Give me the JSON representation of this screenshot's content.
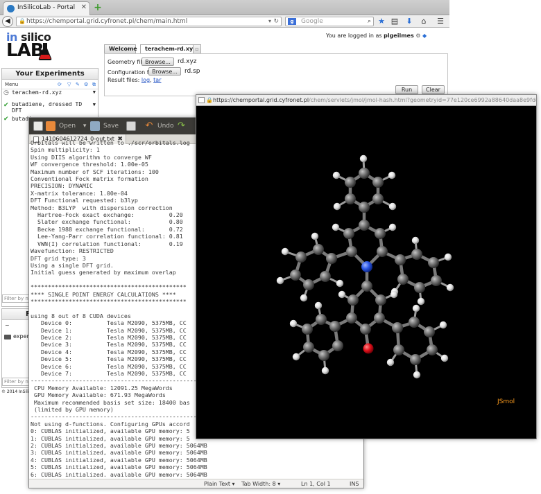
{
  "browser": {
    "tab_title": "InSilicoLab - Portal",
    "url": "https://chemportal.grid.cyfronet.pl/chem/main.html",
    "search_placeholder": "Google",
    "search_engine_icon": "google-g-icon"
  },
  "portal": {
    "logo_line1_a": "in",
    "logo_line1_b": " silico",
    "logo_line2": "LAB",
    "logged_in_prefix": "You are logged in as",
    "username": "plgeilmes",
    "experiments_panel": {
      "title": "Your Experiments",
      "menu_label": "Menu",
      "items": [
        {
          "label": "terachem-rd.xyz",
          "status": "running"
        },
        {
          "label": "butadiene, dressed TD DFT",
          "status": "done"
        },
        {
          "label": "butadi",
          "status": "done"
        }
      ],
      "filter_placeholder": "Filter by na"
    },
    "files_panel": {
      "title_initial": "F",
      "items": [
        {
          "label": "~"
        },
        {
          "label": "exper"
        }
      ],
      "filter_placeholder": "Filter by na"
    },
    "copyright": "© 2014 InSilico",
    "tabs": [
      {
        "label": "Welcome"
      },
      {
        "label": "terachem-rd.xyz"
      }
    ],
    "form": {
      "geometry_label": "Geometry file:",
      "geometry_value": "rd.xyz",
      "config_label": "Configuration file:",
      "config_value": "rd.sp",
      "browse_label": "Browse...",
      "result_label": "Result files:",
      "result_log": "log",
      "result_sep": ",",
      "result_tar": "tar",
      "run_label": "Run",
      "clear_label": "Clear"
    }
  },
  "editor": {
    "toolbar": {
      "open_label": "Open",
      "save_label": "Save",
      "undo_label": "Undo"
    },
    "tab_title": "1410604612724_0-out.txt",
    "lines": [
      "Orbitals will be written to ./scr/orbitals.log",
      "Spin multiplicity: 1",
      "Using DIIS algorithm to converge WF",
      "WF convergence threshold: 1.00e-05",
      "Maximum number of SCF iterations: 100",
      "Conventional Fock matrix formation",
      "PRECISION: DYNAMIC",
      "X-matrix tolerance: 1.00e-04",
      "DFT Functional requested: b3lyp",
      "Method: B3LYP  with dispersion correction",
      "  Hartree-Fock exact exchange:          0.20",
      "  Slater exchange functional:           0.80",
      "  Becke 1988 exchange functional:       0.72",
      "  Lee-Yang-Parr correlation functional: 0.81",
      "  VWN(I) correlation functional:        0.19",
      "Wavefunction: RESTRICTED",
      "DFT grid type: 3",
      "Using a single DFT grid.",
      "Initial guess generated by maximum overlap",
      "",
      "*********************************************",
      "**** SINGLE POINT ENERGY CALCULATIONS ****",
      "*********************************************",
      "",
      "using 8 out of 8 CUDA devices",
      "   Device 0:          Tesla M2090, 5375MB, CC",
      "   Device 1:          Tesla M2090, 5375MB, CC",
      "   Device 2:          Tesla M2090, 5375MB, CC",
      "   Device 3:          Tesla M2090, 5375MB, CC",
      "   Device 4:          Tesla M2090, 5375MB, CC",
      "   Device 5:          Tesla M2090, 5375MB, CC",
      "   Device 6:          Tesla M2090, 5375MB, CC",
      "   Device 7:          Tesla M2090, 5375MB, CC",
      "----------------------------------------------------------",
      " CPU Memory Available: 12091.25 MegaWords",
      " GPU Memory Available: 671.93 MegaWords",
      " Maximum recommended basis set size: 18400 bas",
      " (limited by GPU memory)",
      "----------------------------------------------------------",
      "Not using d-functions. Configuring GPUs accord",
      "0: CUBLAS initialized, available GPU memory: 5",
      "1: CUBLAS initialized, available GPU memory: 5",
      "2: CUBLAS initialized, available GPU memory: 5064MB",
      "3: CUBLAS initialized, available GPU memory: 5064MB",
      "4: CUBLAS initialized, available GPU memory: 5064MB",
      "5: CUBLAS initialized, available GPU memory: 5064MB",
      "6: CUBLAS initialized, available GPU memory: 5064MB"
    ],
    "status": {
      "syntax": "Plain Text",
      "tab_width": "Tab Width: 8",
      "position": "Ln 1, Col 1",
      "mode": "INS"
    }
  },
  "jsmol": {
    "url_prefix": "https://chemportal.grid.cyfronet.pl",
    "url_rest": "/chem/servlets/jmol/jmol-hash.html?geometryid=77e120ce6992a88640daa8e9fdc",
    "label": "JSmol"
  },
  "colors": {
    "carbon": "#6e6e6e",
    "hydrogen": "#e8e8e8",
    "nitrogen": "#2a56e6",
    "oxygen": "#e0101a",
    "jsmol_label": "#ff9d1e",
    "link": "#2252c4"
  }
}
